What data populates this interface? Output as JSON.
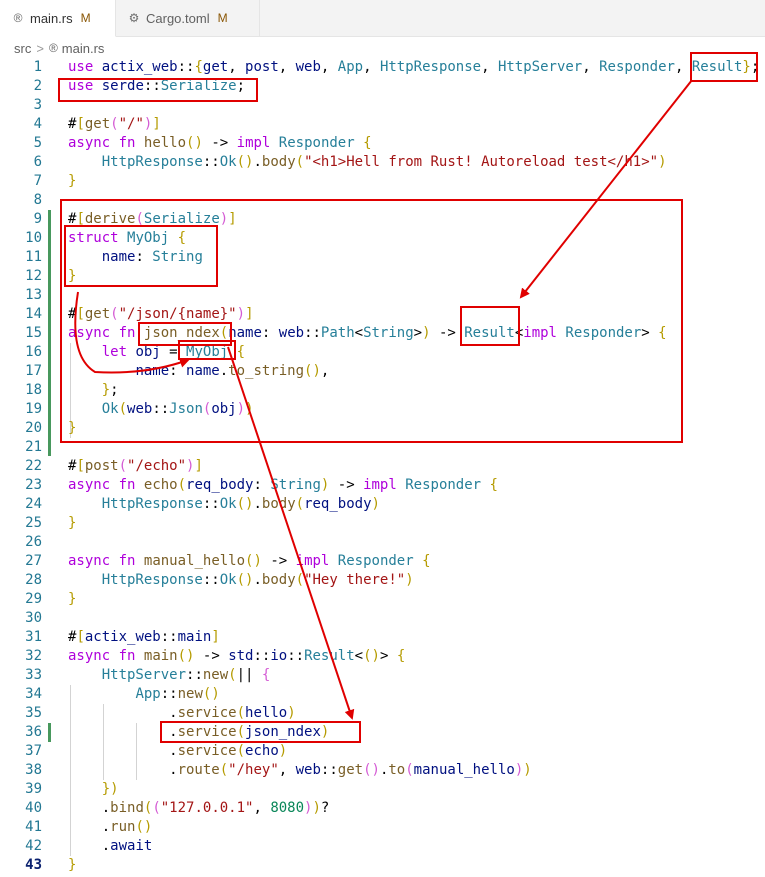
{
  "tabs": [
    {
      "icon": "rust-file-icon",
      "label": "main.rs",
      "modified": "M"
    },
    {
      "icon": "settings-file-icon",
      "label": "Cargo.toml",
      "modified": "M"
    }
  ],
  "breadcrumb": {
    "folder": "src",
    "separator": ">",
    "file": "main.rs"
  },
  "editor": {
    "language": "rust",
    "current_line": 43,
    "colors": {
      "annotation": "#e00000",
      "line_number": "#237893",
      "gutter_modified": "#48985d"
    },
    "line_numbers": [
      "1",
      "2",
      "3",
      "4",
      "5",
      "6",
      "7",
      "8",
      "9",
      "10",
      "11",
      "12",
      "13",
      "14",
      "15",
      "16",
      "17",
      "18",
      "19",
      "20",
      "21",
      "22",
      "23",
      "24",
      "25",
      "26",
      "27",
      "28",
      "29",
      "30",
      "31",
      "32",
      "33",
      "34",
      "35",
      "36",
      "37",
      "38",
      "39",
      "40",
      "41",
      "42",
      "43"
    ],
    "lines": [
      "use actix_web::{get, post, web, App, HttpResponse, HttpServer, Responder, Result};",
      "use serde::Serialize;",
      "",
      "#[get(\"/\")]",
      "async fn hello() -> impl Responder {",
      "    HttpResponse::Ok().body(\"<h1>Hell from Rust! Autoreload test</h1>\")",
      "}",
      "",
      "#[derive(Serialize)]",
      "struct MyObj {",
      "    name: String",
      "}",
      "",
      "#[get(\"/json/{name}\")]",
      "async fn json_ndex(name: web::Path<String>) -> Result<impl Responder> {",
      "    let obj = MyObj {",
      "        name: name.to_string(),",
      "    };",
      "    Ok(web::Json(obj))",
      "}",
      "",
      "#[post(\"/echo\")]",
      "async fn echo(req_body: String) -> impl Responder {",
      "    HttpResponse::Ok().body(req_body)",
      "}",
      "",
      "async fn manual_hello() -> impl Responder {",
      "    HttpResponse::Ok().body(\"Hey there!\")",
      "}",
      "",
      "#[actix_web::main]",
      "async fn main() -> std::io::Result<()> {",
      "    HttpServer::new(|| {",
      "        App::new()",
      "            .service(hello)",
      "            .service(json_ndex)",
      "            .service(echo)",
      "            .route(\"/hey\", web::get().to(manual_hello))",
      "    })",
      "    .bind((\"127.0.0.1\", 8080))?",
      "    .run()",
      "    .await",
      "}"
    ]
  }
}
